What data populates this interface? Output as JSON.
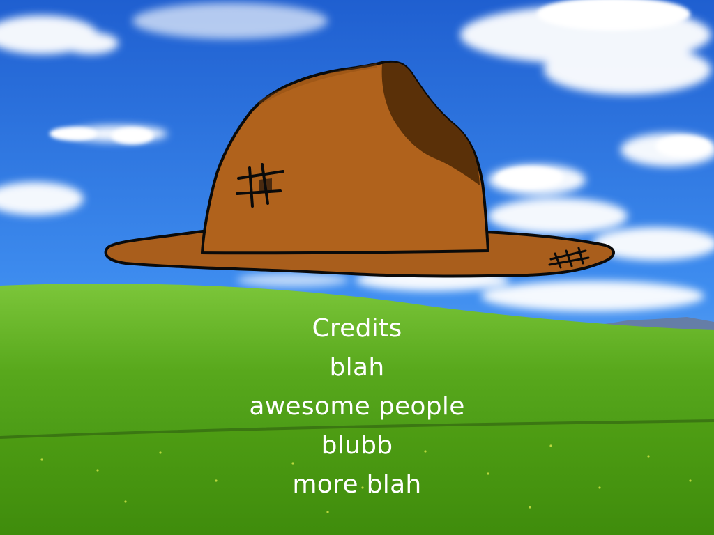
{
  "screen": "credits",
  "credits": {
    "title": "Credits",
    "lines": [
      "blah",
      "awesome people",
      "blubb",
      "more blah"
    ]
  },
  "scene": {
    "background": "bliss-hills-wallpaper",
    "floating_object": "brown-patched-hat",
    "colors": {
      "sky": "#2a6fd8",
      "grass": "#4c9d12",
      "hat": "#b0621c",
      "hat_shadow": "#5a3008",
      "text": "#ffffff"
    }
  }
}
